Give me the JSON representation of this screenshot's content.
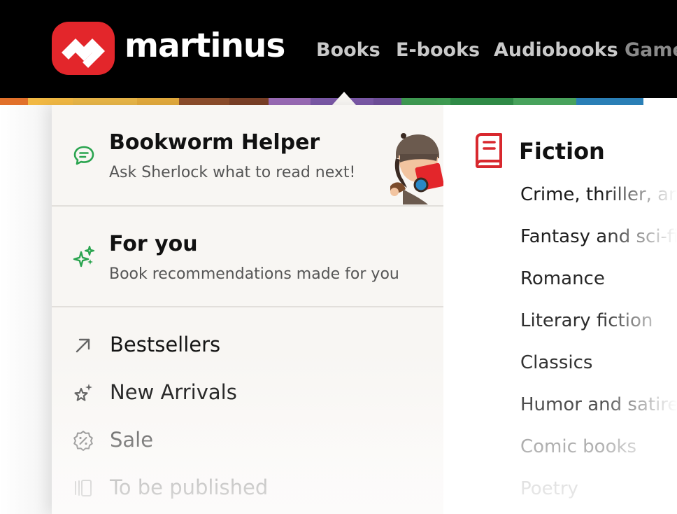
{
  "brand": {
    "name": "martinus",
    "accent": "#e3262b"
  },
  "nav": {
    "items": [
      {
        "label": "Books"
      },
      {
        "label": "E-books"
      },
      {
        "label": "Audiobooks"
      },
      {
        "label": "Games"
      }
    ]
  },
  "menu": {
    "features": [
      {
        "title": "Bookworm Helper",
        "subtitle": "Ask Sherlock what to read next!",
        "icon": "chat-bubble-icon",
        "color": "#2aa44f"
      },
      {
        "title": "For you",
        "subtitle": "Book recommendations made for you",
        "icon": "sparkles-icon",
        "color": "#2aa44f"
      }
    ],
    "links": [
      {
        "label": "Bestsellers",
        "icon": "arrow-up-right-icon"
      },
      {
        "label": "New Arrivals",
        "icon": "star-sparkle-icon"
      },
      {
        "label": "Sale",
        "icon": "discount-badge-icon"
      },
      {
        "label": "To be published",
        "icon": "book-stack-icon"
      }
    ]
  },
  "fiction": {
    "title": "Fiction",
    "icon": "book-icon",
    "icon_color": "#d8282e",
    "categories": [
      "Crime, thriller, and",
      "Fantasy and sci-fi",
      "Romance",
      "Literary fiction",
      "Classics",
      "Humor and satire",
      "Comic books",
      "Poetry"
    ]
  }
}
